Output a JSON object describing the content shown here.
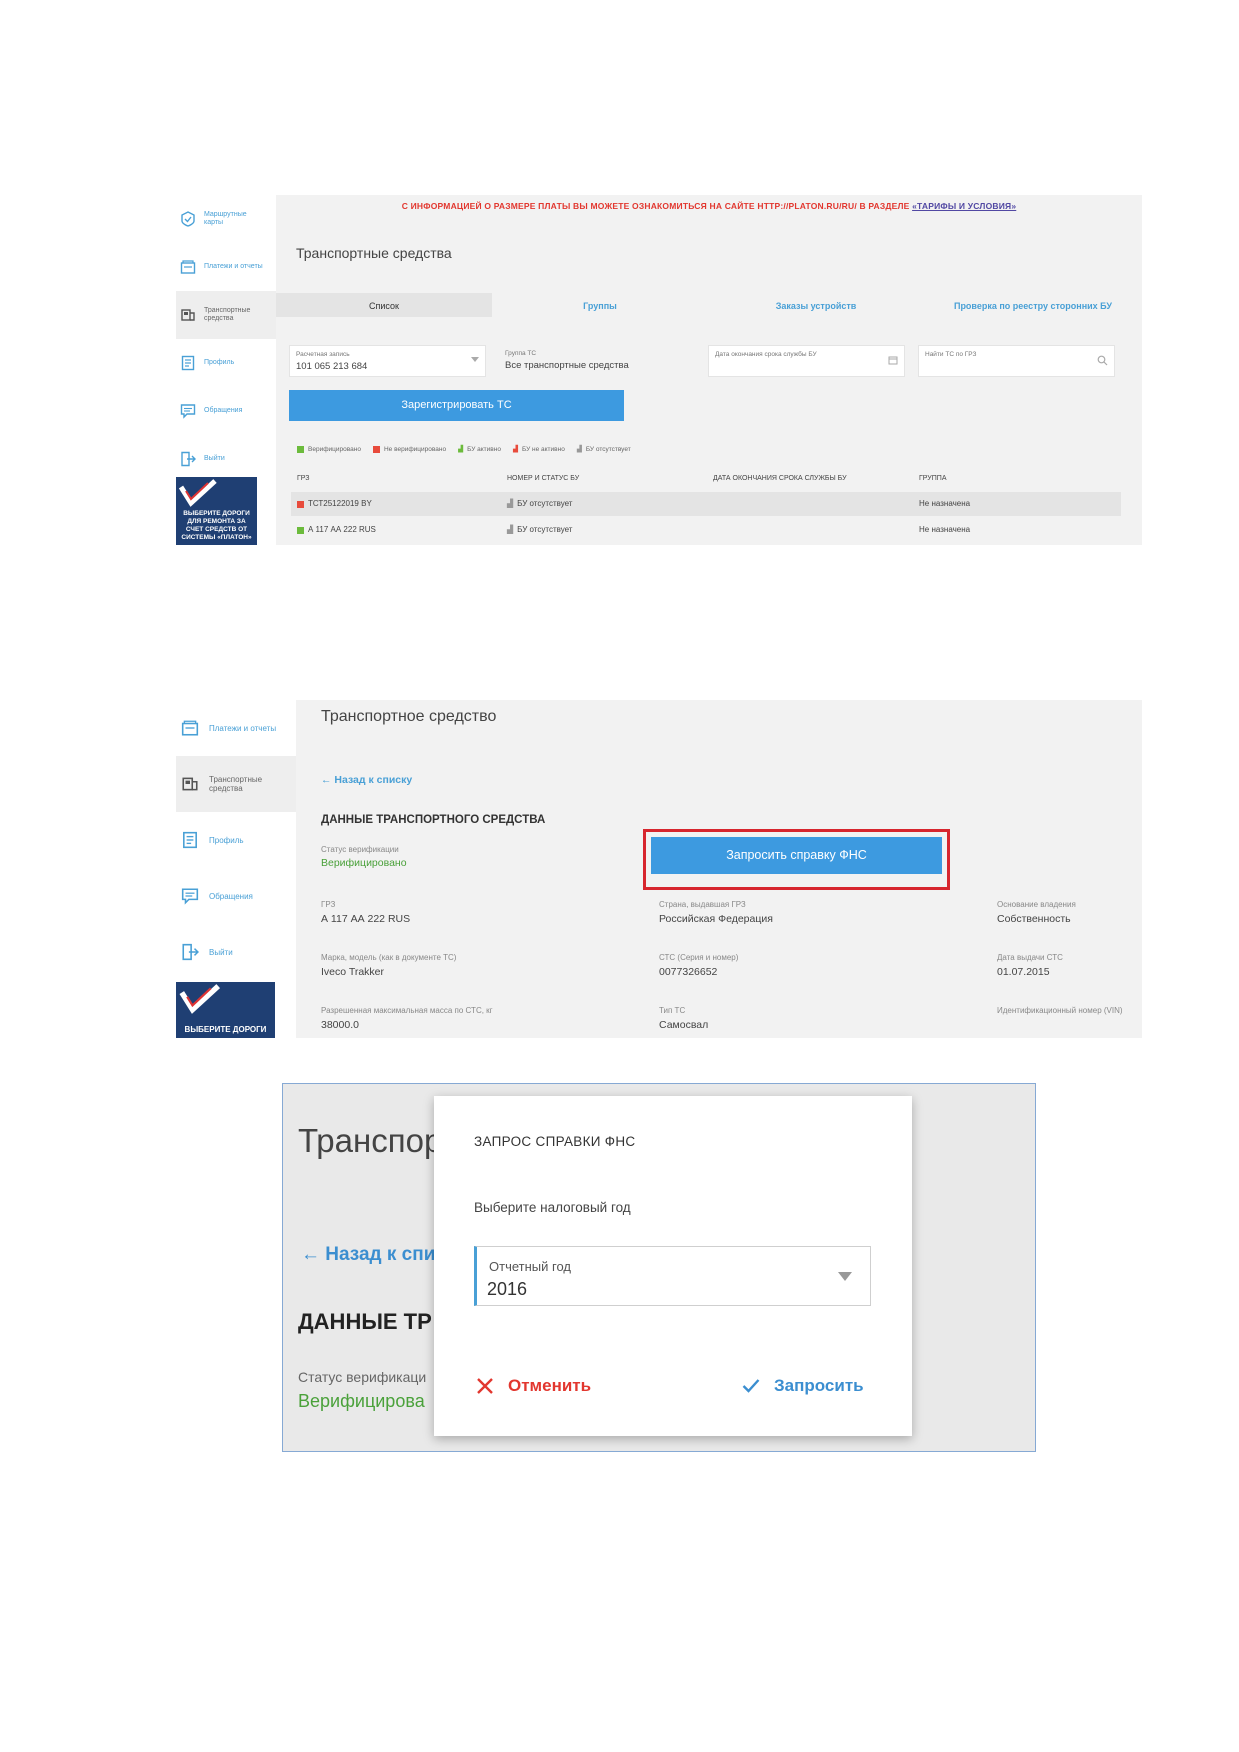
{
  "shot1": {
    "sidebar": [
      {
        "label": "Маршрутные\nкарты",
        "icon": "route-card-icon"
      },
      {
        "label": "Платежи и отчеты",
        "icon": "payments-icon"
      },
      {
        "label": "Транспортные\nсредства",
        "icon": "truck-icon",
        "active": true
      },
      {
        "label": "Профиль",
        "icon": "profile-icon"
      },
      {
        "label": "Обращения",
        "icon": "message-icon"
      },
      {
        "label": "Выйти",
        "icon": "logout-icon"
      }
    ],
    "banner": "ВЫБЕРИТЕ ДОРОГИ ДЛЯ РЕМОНТА ЗА СЧЕТ СРЕДСТВ ОТ СИСТЕМЫ «ПЛАТОН»",
    "notice": {
      "text": "С ИНФОРМАЦИЕЙ О РАЗМЕРЕ ПЛАТЫ ВЫ МОЖЕТЕ ОЗНАКОМИТЬСЯ НА САЙТЕ HTTP://PLATON.RU/RU/ В РАЗДЕЛЕ ",
      "link": "«ТАРИФЫ И УСЛОВИЯ»"
    },
    "title": "Транспортные средства",
    "tabs": [
      "Список",
      "Группы",
      "Заказы устройств",
      "Проверка по реестру сторонних БУ"
    ],
    "filters": {
      "account_label": "Расчетная запись",
      "account_value": "101 065 213 684",
      "group_label": "Группа ТС",
      "group_value": "Все транспортные средства",
      "date_label": "Дата окончания срока службы БУ",
      "search_label": "Найти ТС по ГРЗ"
    },
    "register_button": "Зарегистрировать ТС",
    "legend": [
      "Верифицировано",
      "Не верифицировано",
      "БУ активно",
      "БУ не активно",
      "БУ отсутствует"
    ],
    "table": {
      "headers": [
        "ГРЗ",
        "НОМЕР И СТАТУС БУ",
        "ДАТА ОКОНЧАНИЯ СРОКА СЛУЖБЫ БУ",
        "ГРУППА"
      ],
      "rows": [
        {
          "plate": "ТСТ25122019 BY",
          "status": "БУ отсутствует",
          "date": "",
          "group": "Не назначена",
          "verified": false
        },
        {
          "plate": "А 117 АА 222 RUS",
          "status": "БУ отсутствует",
          "date": "",
          "group": "Не назначена",
          "verified": true
        }
      ]
    }
  },
  "shot2": {
    "sidebar": [
      {
        "label": "Платежи и отчеты",
        "icon": "payments-icon"
      },
      {
        "label": "Транспортные\nсредства",
        "icon": "truck-icon",
        "active": true
      },
      {
        "label": "Профиль",
        "icon": "profile-icon"
      },
      {
        "label": "Обращения",
        "icon": "message-icon"
      },
      {
        "label": "Выйти",
        "icon": "logout-icon"
      }
    ],
    "banner": "ВЫБЕРИТЕ ДОРОГИ",
    "title": "Транспортное средство",
    "back": "← Назад к списку",
    "section": "ДАННЫЕ ТРАНСПОРТНОГО СРЕДСТВА",
    "status_label": "Статус верификации",
    "status_value": "Верифицировано",
    "request_button": "Запросить справку ФНС",
    "fields": [
      {
        "label": "ГРЗ",
        "value": "А 117 АА 222 RUS"
      },
      {
        "label": "Страна, выдавшая ГРЗ",
        "value": "Российская Федерация"
      },
      {
        "label": "Основание владения",
        "value": "Собственность"
      },
      {
        "label": "Марка, модель (как в документе ТС)",
        "value": "Iveco Trakker"
      },
      {
        "label": "СТС (Серия и номер)",
        "value": "0077326652"
      },
      {
        "label": "Дата выдачи СТС",
        "value": "01.07.2015"
      },
      {
        "label": "Разрешенная максимальная масса по СТС, кг",
        "value": "38000.0"
      },
      {
        "label": "Тип ТС",
        "value": "Самосвал"
      },
      {
        "label": "Идентификационный номер (VIN)",
        "value": ""
      }
    ]
  },
  "shot3": {
    "bg_title": "Транспор",
    "bg_back": "← Назад к спи",
    "bg_section": "ДАННЫЕ ТР",
    "bg_status_label": "Статус верификаци",
    "bg_status_value": "Верифицирова",
    "modal": {
      "title": "ЗАПРОС СПРАВКИ ФНС",
      "prompt": "Выберите налоговый год",
      "select_label": "Отчетный год",
      "select_value": "2016",
      "cancel": "Отменить",
      "submit": "Запросить"
    }
  },
  "colors": {
    "accent": "#3d9ae0",
    "link": "#49a0d6",
    "green": "#4aa13a",
    "red": "#e2372f",
    "highlight": "#d7262e"
  }
}
